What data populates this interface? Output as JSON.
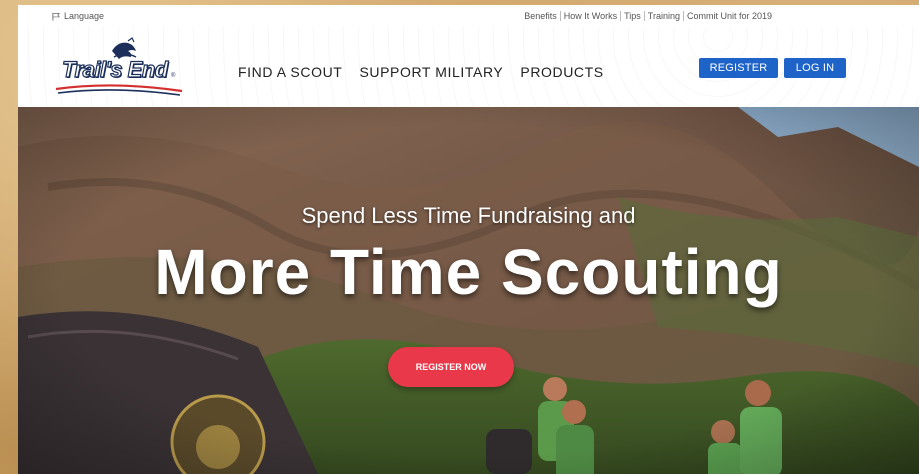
{
  "utility_bar": {
    "language_label": "Language",
    "links": [
      "Benefits",
      "How It Works",
      "Tips",
      "Training",
      "Commit Unit for 2019"
    ]
  },
  "header": {
    "logo_text": "Trail's End",
    "logo_reg": "®",
    "nav": [
      "FIND A SCOUT",
      "SUPPORT MILITARY",
      "PRODUCTS"
    ],
    "register_label": "REGISTER",
    "login_label": "LOG IN"
  },
  "hero": {
    "subtitle": "Spend Less Time Fundraising and",
    "title": "More Time Scouting",
    "cta_label": "REGISTER NOW"
  },
  "colors": {
    "button_blue": "#1e64c8",
    "cta_red": "#e8384a",
    "logo_navy": "#1b2f5a",
    "logo_red": "#d32f2f"
  },
  "icons": [
    "flag-icon"
  ]
}
